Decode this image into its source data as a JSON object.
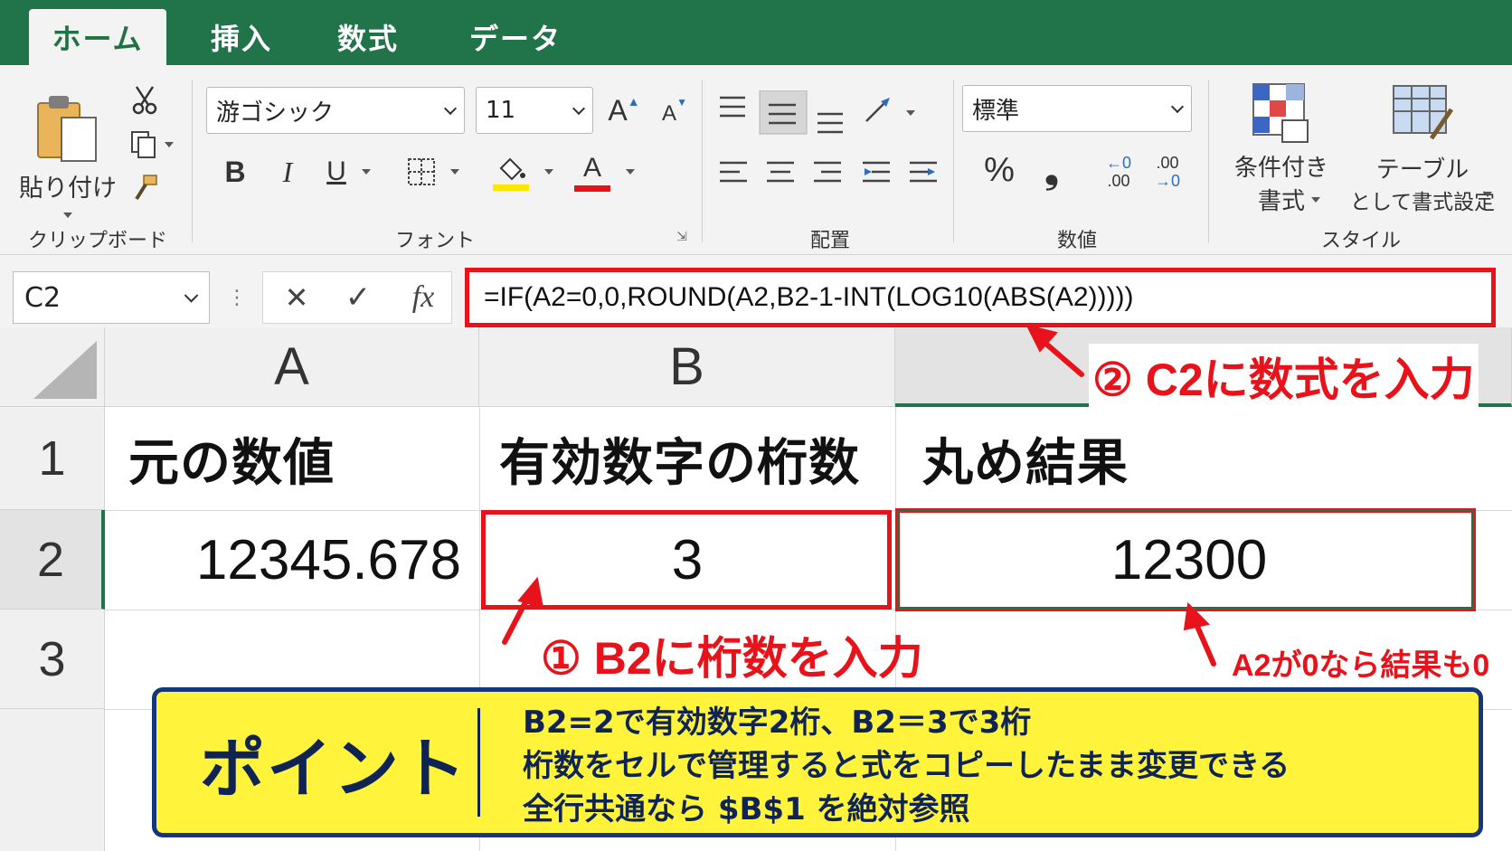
{
  "tabs": [
    {
      "label": "ホーム",
      "active": true
    },
    {
      "label": "挿入",
      "active": false
    },
    {
      "label": "数式",
      "active": false
    },
    {
      "label": "データ",
      "active": false
    }
  ],
  "ribbon": {
    "clipboard": {
      "paste_label": "貼り付け",
      "group_label": "クリップボード"
    },
    "font": {
      "font_name": "游ゴシック",
      "font_size": "11",
      "bold": "B",
      "italic": "I",
      "underline": "U",
      "font_color_glyph": "A",
      "grow_glyph": "A",
      "shrink_glyph": "A",
      "group_label": "フォント"
    },
    "alignment": {
      "group_label": "配置"
    },
    "number": {
      "format": "標準",
      "percent": "%",
      "comma": "❟",
      "inc_decimal_top": "←0",
      "inc_decimal_bottom": ".00",
      "dec_decimal_top": ".00",
      "dec_decimal_bottom": "→0",
      "group_label": "数値"
    },
    "styles": {
      "conditional_line1": "条件付き",
      "conditional_line2": "書式",
      "table_line1": "テーブル",
      "table_line2": "として書式設定",
      "group_label": "スタイル"
    }
  },
  "formula_bar": {
    "name_box": "C2",
    "cancel": "✕",
    "enter": "✓",
    "fx": "fx",
    "formula": "=IF(A2=0,0,ROUND(A2,B2-1-INT(LOG10(ABS(A2)))))"
  },
  "sheet": {
    "columns": [
      "A",
      "B"
    ],
    "rows": [
      "1",
      "2",
      "3"
    ],
    "headers": [
      "元の数値",
      "有効数字の桁数",
      "丸め結果"
    ],
    "row2": {
      "a": "12345.678",
      "b": "3",
      "c": "12300"
    }
  },
  "callouts": {
    "step1": "① B2に桁数を入力",
    "step2": "② C2に数式を入力",
    "note": "A2が0なら結果も0"
  },
  "point": {
    "title": "ポイント",
    "lines": [
      "B2=2で有効数字2桁、B2＝3で3桁",
      "桁数をセルで管理すると式をコピーしたまま変更できる",
      "全行共通なら $B$1 を絶対参照"
    ]
  },
  "colors": {
    "excel_green": "#21744a",
    "callout_red": "#e8131a",
    "point_yellow": "#fff43b",
    "point_navy": "#17357a"
  }
}
